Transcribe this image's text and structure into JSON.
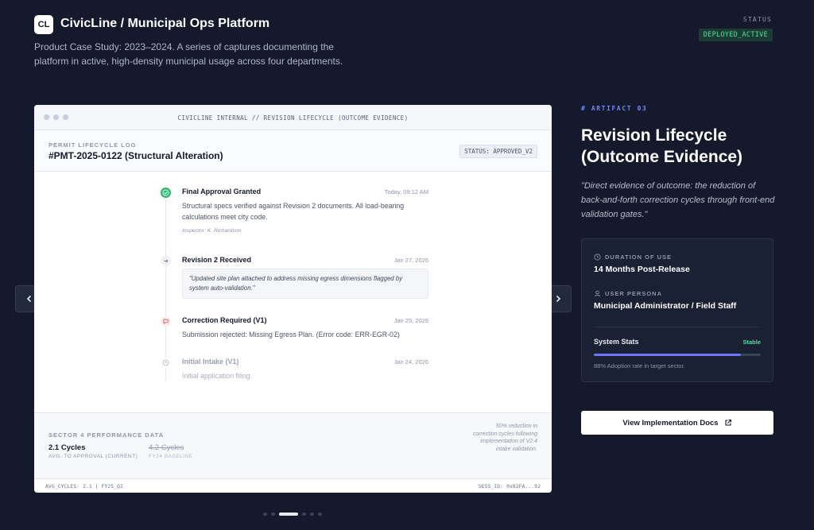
{
  "header": {
    "logo_text": "CL",
    "title": "CivicLine / Municipal Ops Platform",
    "description": "Product Case Study: 2023–2024. A series of captures documenting the platform in active, high-density municipal usage across four departments.",
    "status_label": "STATUS",
    "status_value": "DEPLOYED_ACTIVE"
  },
  "nav": {
    "prev_icon": "chevron-left-icon",
    "next_icon": "chevron-right-icon"
  },
  "card": {
    "titlebar": "CIVICLINE INTERNAL // REVISION LIFECYCLE (OUTCOME EVIDENCE)",
    "log_label": "PERMIT LIFECYCLE LOG",
    "permit_id": "#PMT-2025-0122 (Structural Alteration)",
    "permit_status": "STATUS: APPROVED_V2",
    "events": [
      {
        "title": "Final Approval Granted",
        "time": "Today, 09:12 AM",
        "desc": "Structural specs verified against Revision 2 documents. All load-bearing calculations meet city code.",
        "meta": "Inspector: K. Richardson",
        "icon": "check-circle-icon"
      },
      {
        "title": "Revision 2 Received",
        "time": "Jan 27, 2026",
        "quote": "\"Updated site plan attached to address missing egress dimensions flagged by system auto-validation.\"",
        "icon": "arrow-right-icon"
      },
      {
        "title": "Correction Required (V1)",
        "time": "Jan 25, 2026",
        "desc": "Submission rejected: Missing Egress Plan. (Error code: ERR-EGR-02)",
        "icon": "comment-alert-icon"
      },
      {
        "title": "Initial Intake (V1)",
        "time": "Jan 24, 2026",
        "desc": "Initial application filing.",
        "icon": "clock-icon"
      }
    ],
    "footer": {
      "sector_label": "SECTOR 4 PERFORMANCE DATA",
      "current_value": "2.1 Cycles",
      "current_label": "AVG. TO APPROVAL (CURRENT)",
      "baseline_value": "4.2 Cycles",
      "baseline_label": "FY24 BASELINE",
      "note": "50% reduction in correction cycles following implementation of V2.4 intake validation."
    },
    "statusbar": {
      "left": "AVG_CYCLES: 2.1 | FY25_Q2",
      "right": "SESS_ID: 0x82FA...92"
    }
  },
  "artifact": {
    "label": "# ARTIFACT 03",
    "title": "Revision Lifecycle (Outcome Evidence)",
    "quote": "\"Direct evidence of outcome: the reduction of back-and-forth correction cycles through front-end validation gates.\"",
    "duration_label": "DURATION OF USE",
    "duration_value": "14 Months Post-Release",
    "persona_label": "USER PERSONA",
    "persona_value": "Municipal Administrator / Field Staff",
    "stats_label": "System Stats",
    "stats_state": "Stable",
    "adoption_fraction": 0.88,
    "adoption_caption": "88% Adoption rate in target sector.",
    "docs_button": "View Implementation Docs"
  },
  "colors": {
    "background": "#141a2b",
    "accent": "#6f75ff",
    "success": "#4ee0a0",
    "error": "#e35d6a"
  },
  "pager": {
    "count": 6,
    "active": 2
  }
}
